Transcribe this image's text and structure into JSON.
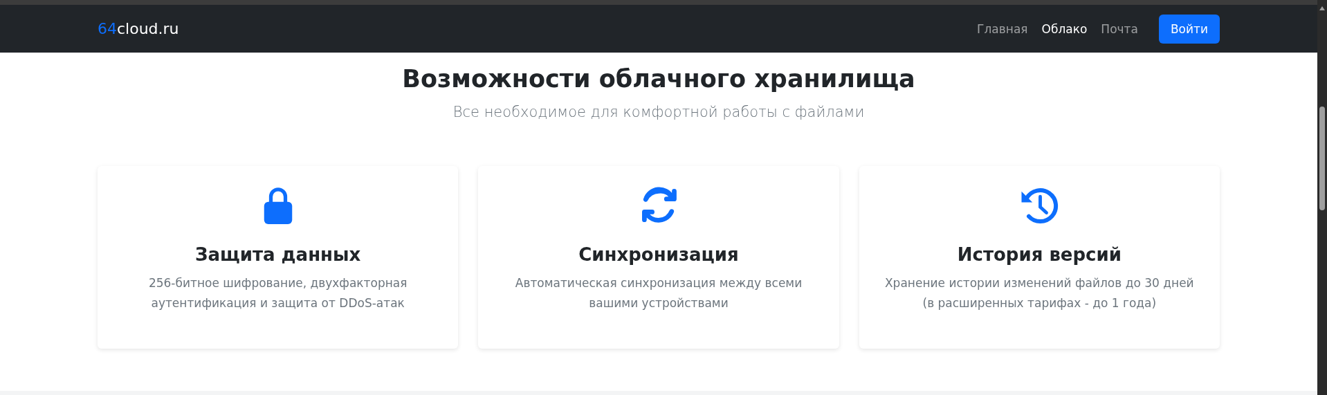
{
  "navbar": {
    "brand": {
      "accent": "64",
      "rest": "cloud.ru"
    },
    "links": [
      {
        "label": "Главная",
        "selected": false
      },
      {
        "label": "Облако",
        "selected": true
      },
      {
        "label": "Почта",
        "selected": false
      }
    ],
    "button": "Войти"
  },
  "section": {
    "title": "Возможности облачного хранилища",
    "subtitle": "Все необходимое для комфортной работы с файлами",
    "features": [
      {
        "kind": "lock",
        "title": "Защита данных",
        "text": "256-битное шифрование, двухфакторная аутентификация и защита от DDoS-атак"
      },
      {
        "kind": "sync",
        "title": "Синхронизация",
        "text": "Автоматическая синхронизация между всеми вашими устройствами"
      },
      {
        "kind": "history",
        "title": "История версий",
        "text": "Хранение истории изменений файлов до 30 дней (в расширенных тарифах - до 1 года)"
      }
    ]
  }
}
